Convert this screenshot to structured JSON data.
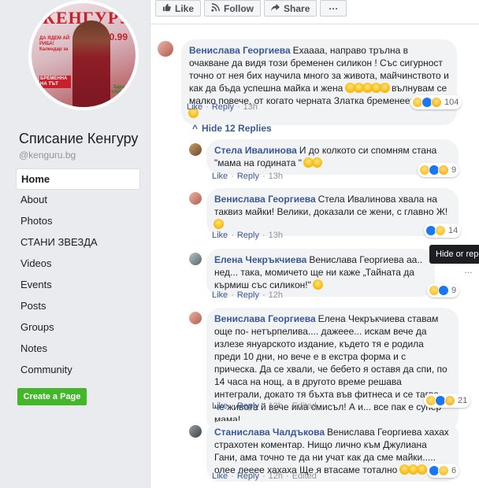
{
  "sidebar": {
    "page_name": "Списание Кенгуру",
    "page_handle": "@kenguru.bg",
    "cover": {
      "masthead": "КЕНГУРУ",
      "price": "0.99",
      "tagline_1": "ДА ЯДЕМ АЙ РИБА!",
      "tagline_2": "Календар за",
      "tagline_3": "БРЕМЕННА НА ТЪТ",
      "tagline_green": "Здрав спусък"
    },
    "nav": [
      {
        "label": "Home",
        "active": true
      },
      {
        "label": "About"
      },
      {
        "label": "Photos"
      },
      {
        "label": "СТАНИ ЗВЕЗДА"
      },
      {
        "label": "Videos"
      },
      {
        "label": "Events"
      },
      {
        "label": "Posts"
      },
      {
        "label": "Groups"
      },
      {
        "label": "Notes"
      },
      {
        "label": "Community"
      }
    ],
    "create_page": "Create a Page"
  },
  "toolbar": {
    "like": "Like",
    "follow": "Follow",
    "share": "Share",
    "more": "···"
  },
  "comments": {
    "main": {
      "author": "Венислава Георгиева",
      "text": "Ехаааа, направо трълна в очакване да видя този бременен силикон ! Със сигурност точно от нея бих научила много за живота, майчинството и как да бъда успешна майка и жена",
      "text_tail": "вълнувам се малко повече, от когато черната Златка бременееше",
      "time": "13h",
      "reactions": "104"
    },
    "hide_replies": "Hide 12 Replies",
    "replies": [
      {
        "author": "Стела Ивалинова",
        "text": "И до колкото си спомням стана \"мама на годината \"",
        "time": "13h",
        "reactions": "9",
        "edited": ""
      },
      {
        "author": "Венислава Георгиева",
        "text": "Стела Ивалинова хвала на таквиз майки! Велики, доказали се жени, с главно Ж!",
        "time": "13h",
        "reactions": "14",
        "edited": ""
      },
      {
        "author": "Елена Чекръкчиева",
        "text": "Венислава Георгиева аа.. нед... така, момичето ще ни каже „Тайната да кърмиш със силикон!\"",
        "time": "12h",
        "reactions": "9",
        "edited": ""
      },
      {
        "author": "Венислава Георгиева",
        "text": "Елена Чекръкчиева ставам още по- нетърпелива.... дажееe... искам вече да излезе януарското издание, където тя е родила преди 10 дни, но вече е в екстра форма и с прическа. Да се хвали, че бебето я оставя да спи, по 14 часа на нощ, а в другото време решава интеграли, докато тя бъхта във фитнеса и се тагва, че живота й вече има смисъл! А и... все пак е супер мама!",
        "time": "12h",
        "reactions": "21",
        "edited": "Edited"
      },
      {
        "author": "Станислава Чалдъкова",
        "text": "Венислава Георгиева хахах страхотен коментар. Нищо лично към Джулиана Гани, ама точно те да ни учат как да сме майки..... олее лееее хахаха Ще я втасаме тотално",
        "time": "12h",
        "reactions": "6",
        "edited": "Edited"
      }
    ],
    "action_like": "Like",
    "action_reply": "Reply"
  },
  "tooltip": "Hide or repo",
  "options_icon": "···"
}
